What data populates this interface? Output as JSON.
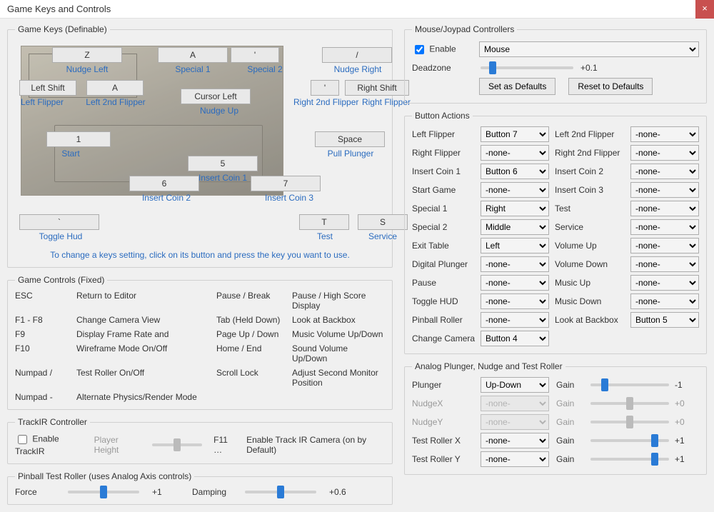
{
  "window": {
    "title": "Game Keys and Controls"
  },
  "gameKeysGroup": "Game Keys (Definable)",
  "keys": {
    "nudgeLeft": {
      "key": "Z",
      "label": "Nudge Left"
    },
    "special1": {
      "key": "A",
      "label": "Special 1"
    },
    "special2": {
      "key": "'",
      "label": "Special 2"
    },
    "nudgeRight": {
      "key": "/",
      "label": "Nudge Right"
    },
    "leftFlipper": {
      "key": "Left Shift",
      "label": "Left Flipper"
    },
    "left2ndFlip": {
      "key": "A",
      "label": "Left 2nd Flipper"
    },
    "nudgeUp": {
      "key": "Cursor Left",
      "label": "Nudge Up"
    },
    "right2ndFlip": {
      "key": "'",
      "label": "Right 2nd Flipper"
    },
    "rightFlipper": {
      "key": "Right Shift",
      "label": "Right Flipper"
    },
    "start": {
      "key": "1",
      "label": "Start"
    },
    "plunger": {
      "key": "Space",
      "label": "Pull Plunger"
    },
    "coin1": {
      "key": "5",
      "label": "Insert Coin 1"
    },
    "coin2": {
      "key": "6",
      "label": "Insert Coin 2"
    },
    "coin3": {
      "key": "7",
      "label": "Insert Coin 3"
    },
    "toggleHud": {
      "key": "`",
      "label": "Toggle Hud"
    },
    "test": {
      "key": "T",
      "label": "Test"
    },
    "service": {
      "key": "S",
      "label": "Service"
    }
  },
  "hint": "To change a keys setting, click on its button and press the key you want to use.",
  "fixedGroup": "Game Controls (Fixed)",
  "fixed": [
    [
      "ESC",
      "Return to Editor",
      "Pause / Break",
      "Pause / High Score Display"
    ],
    [
      "F1 - F8",
      "Change Camera View",
      "Tab (Held Down)",
      "Look at Backbox"
    ],
    [
      "F9",
      "Display Frame Rate and",
      "Page Up / Down",
      "Music Volume Up/Down"
    ],
    [
      "F10",
      "Wireframe Mode On/Off",
      "Home / End",
      "Sound Volume Up/Down"
    ],
    [
      "Numpad /",
      "Test Roller On/Off",
      "Scroll Lock",
      "Adjust Second Monitor Position"
    ],
    [
      "Numpad -",
      "Alternate Physics/Render Mode",
      "",
      ""
    ]
  ],
  "trackir": {
    "group": "TrackIR Controller",
    "enableLabel": "Enable TrackIR",
    "playerHeightLabel": "Player Height",
    "f11": "F11 …",
    "desc": "Enable Track IR Camera (on by Default)"
  },
  "testRoller": {
    "group": "Pinball Test Roller (uses Analog Axis controls)",
    "forceLabel": "Force",
    "forceVal": "+1",
    "dampingLabel": "Damping",
    "dampingVal": "+0.6"
  },
  "mouseGroup": "Mouse/Joypad Controllers",
  "mouse": {
    "enableLabel": "Enable",
    "device": "Mouse",
    "deadzoneLabel": "Deadzone",
    "deadzoneVal": "+0.1",
    "setDefaults": "Set as Defaults",
    "resetDefaults": "Reset to Defaults"
  },
  "buttonActionsGroup": "Button Actions",
  "buttonActions": [
    [
      "Left Flipper",
      "Button 7",
      "Left 2nd Flipper",
      "-none-"
    ],
    [
      "Right Flipper",
      "-none-",
      "Right 2nd Flipper",
      "-none-"
    ],
    [
      "Insert Coin 1",
      "Button 6",
      "Insert Coin 2",
      "-none-"
    ],
    [
      "Start Game",
      "-none-",
      "Insert Coin 3",
      "-none-"
    ],
    [
      "Special 1",
      "Right",
      "Test",
      "-none-"
    ],
    [
      "Special 2",
      "Middle",
      "Service",
      "-none-"
    ],
    [
      "Exit Table",
      "Left",
      "Volume Up",
      "-none-"
    ],
    [
      "Digital Plunger",
      "-none-",
      "Volume Down",
      "-none-"
    ],
    [
      "Pause",
      "-none-",
      "Music Up",
      "-none-"
    ],
    [
      "Toggle HUD",
      "-none-",
      "Music Down",
      "-none-"
    ],
    [
      "Pinball Roller",
      "-none-",
      "Look at Backbox",
      "Button 5"
    ],
    [
      "Change Camera",
      "Button 4",
      "",
      ""
    ]
  ],
  "analogGroup": "Analog Plunger, Nudge and Test Roller",
  "gainLabel": "Gain",
  "analog": [
    {
      "label": "Plunger",
      "axis": "Up-Down",
      "gain": "-1",
      "disabled": false,
      "sliderPos": 15
    },
    {
      "label": "NudgeX",
      "axis": "-none-",
      "gain": "+0",
      "disabled": true,
      "sliderPos": 50
    },
    {
      "label": "NudgeY",
      "axis": "-none-",
      "gain": "+0",
      "disabled": true,
      "sliderPos": 50
    },
    {
      "label": "Test Roller X",
      "axis": "-none-",
      "gain": "+1",
      "disabled": false,
      "sliderPos": 85
    },
    {
      "label": "Test Roller Y",
      "axis": "-none-",
      "gain": "+1",
      "disabled": false,
      "sliderPos": 85
    }
  ]
}
